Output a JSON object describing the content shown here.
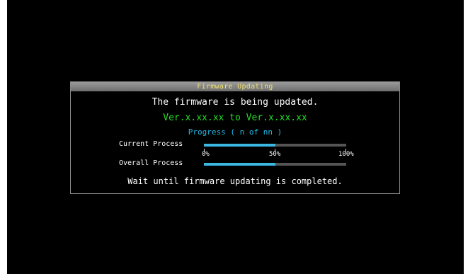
{
  "dialog": {
    "title": "Firmware Updating",
    "message": "The firmware is being updated.",
    "version": "Ver.x.xx.xx to Ver.x.xx.xx",
    "progress_text": "Progress ( n of nn )",
    "current_label": "Current Process",
    "overall_label": "Overall Process",
    "current_progress": 0.5,
    "overall_progress": 0.5,
    "scale": [
      "0%",
      "50%",
      "100%"
    ],
    "wait_message": "Wait until firmware updating is completed."
  },
  "colors": {
    "title_text": "#f0e070",
    "version_text": "#22dd22",
    "progress_text": "#22b8e8",
    "bar_fill": "#3ab8e0",
    "bar_track": "#555555"
  }
}
